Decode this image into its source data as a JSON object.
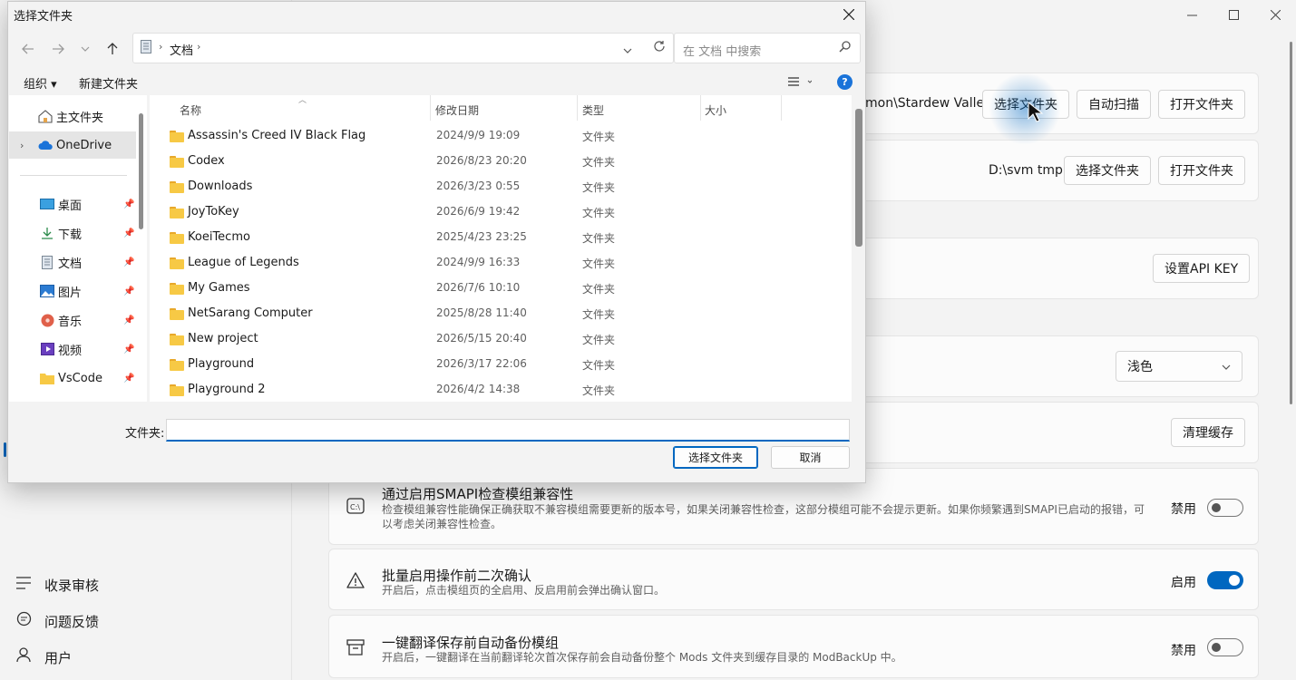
{
  "app": {
    "nav_bottom": [
      {
        "icon": "list-icon",
        "label": "收录审核"
      },
      {
        "icon": "chat-icon",
        "label": "问题反馈"
      },
      {
        "icon": "user-icon",
        "label": "用户"
      }
    ],
    "game_path": {
      "path": "mon\\Stardew Valley",
      "select_label": "选择文件夹",
      "scan_label": "自动扫描",
      "open_label": "打开文件夹"
    },
    "cache_path": {
      "path": "D:\\svm tmp",
      "select_label": "选择文件夹",
      "open_label": "打开文件夹"
    },
    "api": {
      "button_label": "设置API KEY"
    },
    "theme": {
      "selected": "浅色"
    },
    "cache": {
      "button_label": "清理缓存"
    },
    "settings": [
      {
        "icon": "smapi-icon",
        "title": "通过启用SMAPI检查模组兼容性",
        "desc": "检查模组兼容性能确保正确获取不兼容模组需要更新的版本号，如果关闭兼容性检查，这部分模组可能不会提示更新。如果你频繁遇到SMAPI已启动的报错，可以考虑关闭兼容性检查。",
        "state_label": "禁用",
        "on": false
      },
      {
        "icon": "warning-icon",
        "title": "批量启用操作前二次确认",
        "desc": "开启后，点击模组页的全启用、反启用前会弹出确认窗口。",
        "state_label": "启用",
        "on": true
      },
      {
        "icon": "archive-icon",
        "title": "一键翻译保存前自动备份模组",
        "desc": "开启后，一键翻译在当前翻译轮次首次保存前会自动备份整个 Mods 文件夹到缓存目录的 ModBackUp 中。",
        "state_label": "禁用",
        "on": false
      }
    ]
  },
  "dialog": {
    "title": "选择文件夹",
    "breadcrumb": "文档",
    "search_placeholder": "在 文档 中搜索",
    "toolbar": {
      "organize": "组织 ▾",
      "new_folder": "新建文件夹"
    },
    "sidebar": {
      "top": [
        {
          "icon": "home-icon",
          "label": "主文件夹"
        },
        {
          "icon": "onedrive-icon",
          "label": "OneDrive"
        }
      ],
      "pinned": [
        {
          "icon": "desktop-icon",
          "label": "桌面"
        },
        {
          "icon": "download-icon",
          "label": "下载"
        },
        {
          "icon": "documents-icon",
          "label": "文档"
        },
        {
          "icon": "pictures-icon",
          "label": "图片"
        },
        {
          "icon": "music-icon",
          "label": "音乐"
        },
        {
          "icon": "videos-icon",
          "label": "视频"
        },
        {
          "icon": "folder-icon",
          "label": "VsCode"
        }
      ]
    },
    "columns": {
      "name": "名称",
      "modified": "修改日期",
      "type": "类型",
      "size": "大小"
    },
    "files": [
      {
        "name": "Assassin's Creed IV Black Flag",
        "modified": "2024/9/9 19:09",
        "type": "文件夹"
      },
      {
        "name": "Codex",
        "modified": "2026/8/23 20:20",
        "type": "文件夹"
      },
      {
        "name": "Downloads",
        "modified": "2026/3/23 0:55",
        "type": "文件夹"
      },
      {
        "name": "JoyToKey",
        "modified": "2026/6/9 19:42",
        "type": "文件夹"
      },
      {
        "name": "KoeiTecmo",
        "modified": "2025/4/23 23:25",
        "type": "文件夹"
      },
      {
        "name": "League of Legends",
        "modified": "2024/9/9 16:33",
        "type": "文件夹"
      },
      {
        "name": "My Games",
        "modified": "2026/7/6 10:10",
        "type": "文件夹"
      },
      {
        "name": "NetSarang Computer",
        "modified": "2025/8/28 11:40",
        "type": "文件夹"
      },
      {
        "name": "New project",
        "modified": "2026/5/15 20:40",
        "type": "文件夹"
      },
      {
        "name": "Playground",
        "modified": "2026/3/17 22:06",
        "type": "文件夹"
      },
      {
        "name": "Playground 2",
        "modified": "2026/4/2 14:38",
        "type": "文件夹"
      }
    ],
    "folder_label": "文件夹:",
    "folder_value": "",
    "select_button": "选择文件夹",
    "cancel_button": "取消"
  }
}
